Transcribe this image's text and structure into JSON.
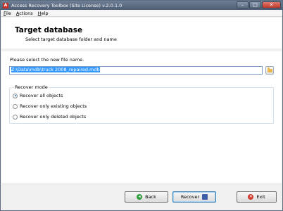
{
  "window": {
    "title": "Access Recovery Toolbox (Site License) v.2.0.1.0",
    "app_icon_letter": "A",
    "controls": {
      "minimize": "–",
      "maximize": "□",
      "close": "✕"
    }
  },
  "menu": {
    "items": [
      {
        "first": "F",
        "rest": "ile"
      },
      {
        "first": "A",
        "rest": "ctions"
      },
      {
        "first": "H",
        "rest": "elp"
      }
    ]
  },
  "header": {
    "title": "Target database",
    "subtitle": "Select target database folder and name"
  },
  "file": {
    "label": "Please select the new file name.",
    "value": "Z:\\Data\\mdb\\truck 2008_repaired.mdb"
  },
  "recover_mode": {
    "title": "Recover mode",
    "options": [
      {
        "label": "Recover all objects",
        "checked": true
      },
      {
        "label": "Recover only existing objects",
        "checked": false
      },
      {
        "label": "Recover only deleted objects",
        "checked": false
      }
    ]
  },
  "footer": {
    "back_label": "Back",
    "recover_label": "Recover",
    "exit_label": "Exit"
  },
  "colors": {
    "titlebar": "#5a6a82",
    "selection": "#3399ff",
    "back_icon": "#2e9e3e",
    "exit_icon": "#d33a2c"
  },
  "icons": {
    "back": "arrow-left-icon",
    "recover": "save-icon",
    "exit": "close-icon",
    "browse": "folder-icon"
  }
}
